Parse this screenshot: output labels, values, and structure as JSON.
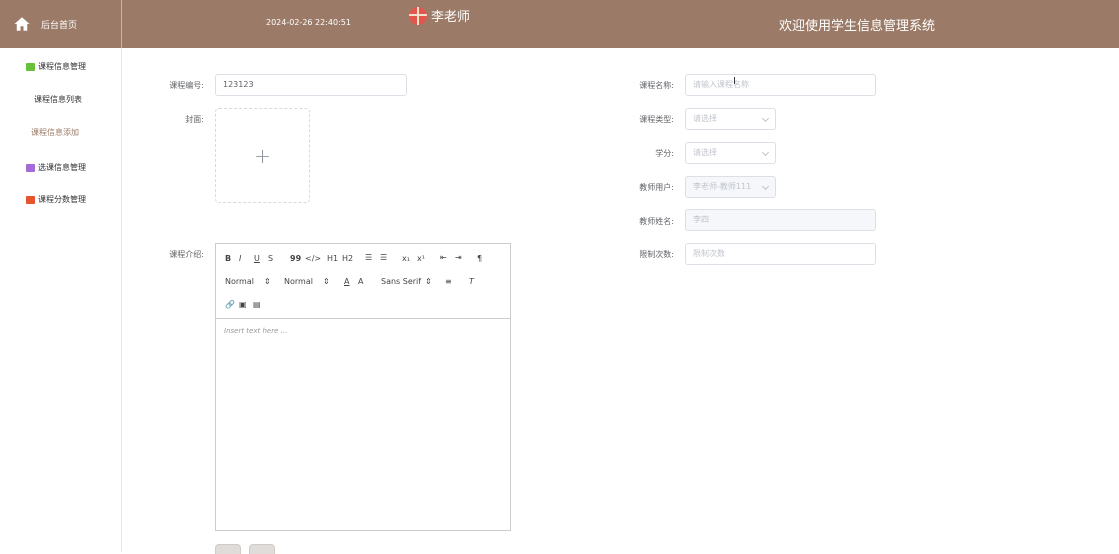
{
  "header": {
    "home_label": "后台首页",
    "datetime": "2024-02-26 22:40:51",
    "user_name": "李老师",
    "system_title": "欢迎使用学生信息管理系统"
  },
  "sidebar": {
    "groups": [
      {
        "label": "课程信息管理",
        "icon": "chat-icon",
        "color": "#67c23a"
      },
      {
        "label": "选课信息管理",
        "icon": "box-icon",
        "color": "#a36ad8"
      },
      {
        "label": "课程分数管理",
        "icon": "grid-icon",
        "color": "#e6552e"
      }
    ],
    "sub_items": [
      {
        "label": "课程信息列表"
      },
      {
        "label": "课程信息添加"
      }
    ]
  },
  "form": {
    "course_code": {
      "label": "课程编号:",
      "value": "123123"
    },
    "cover": {
      "label": "封面:"
    },
    "course_intro": {
      "label": "课程介绍:"
    },
    "course_name": {
      "label": "课程名称:",
      "placeholder": "请输入课程名称"
    },
    "course_type": {
      "label": "课程类型:",
      "placeholder": "请选择"
    },
    "credit": {
      "label": "学分:",
      "placeholder": "请选择"
    },
    "teacher_user": {
      "label": "教师用户:",
      "value": "李老师-教师111"
    },
    "teacher_name": {
      "label": "教师姓名:",
      "value": "李四"
    },
    "limit_count": {
      "label": "限制次数:",
      "placeholder": "限制次数"
    }
  },
  "editor": {
    "header_select": "Normal",
    "size_select": "Normal",
    "font_select": "Sans Serif",
    "placeholder": "Insert text here ..."
  }
}
